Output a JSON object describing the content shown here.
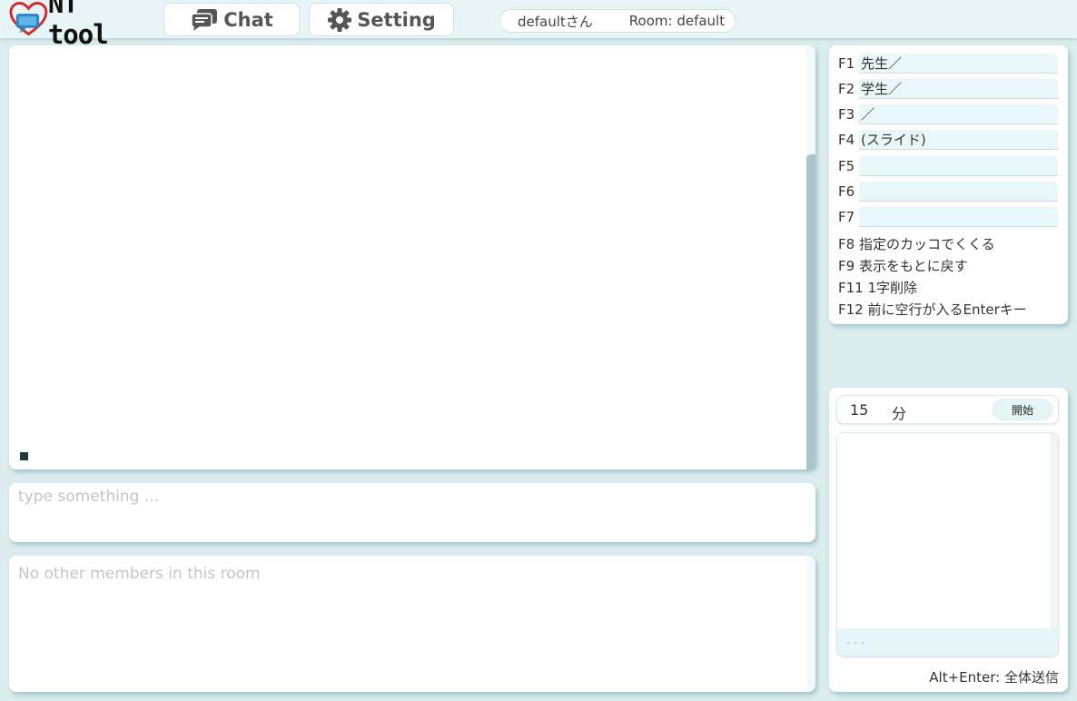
{
  "header": {
    "logo_text": "NT tool",
    "nav": [
      {
        "label": "Chat",
        "icon": "chat-bubbles-icon"
      },
      {
        "label": "Setting",
        "icon": "gear-icon"
      }
    ],
    "user_name": "defaultさん",
    "room": "Room: default"
  },
  "chat": {
    "input_placeholder": "type something ...",
    "members_empty": "No other members in this room"
  },
  "shortcuts": {
    "inputs": [
      {
        "key": "F1",
        "value": "先生／"
      },
      {
        "key": "F2",
        "value": "学生／"
      },
      {
        "key": "F3",
        "value": "／"
      },
      {
        "key": "F4",
        "value": "(スライド)"
      },
      {
        "key": "F5",
        "value": ""
      },
      {
        "key": "F6",
        "value": ""
      },
      {
        "key": "F7",
        "value": ""
      }
    ],
    "fixed": [
      "F8 指定のカッコでくくる",
      "F9 表示をもとに戻す",
      "F11 1字削除",
      "F12 前に空行が入るEnterキー"
    ]
  },
  "timer": {
    "minutes": "15",
    "unit": "分",
    "start_label": "開始",
    "log_footer": ". . .",
    "hint": "Alt+Enter: 全体送信"
  },
  "colors": {
    "background": "#daecee",
    "accent_light": "#e8f8fa",
    "scrollbar": "#a8c6c7"
  }
}
